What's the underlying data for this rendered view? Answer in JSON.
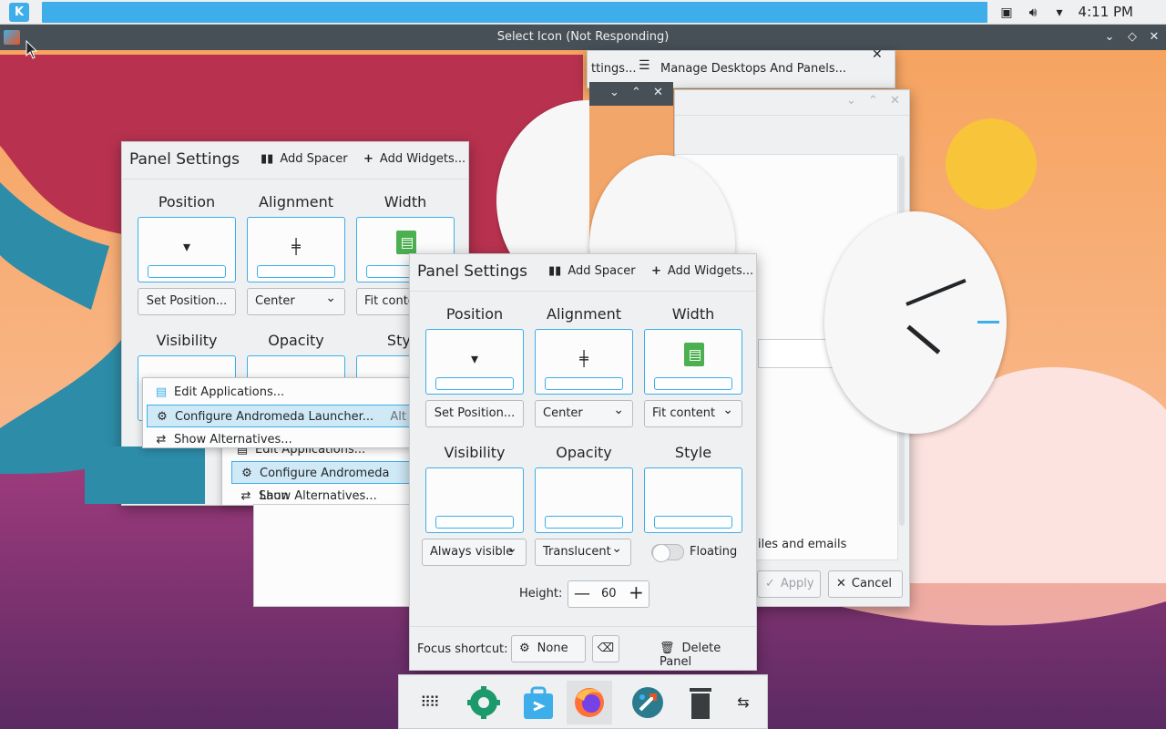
{
  "top_panel": {
    "logo_text": "K",
    "clock": "4:11 PM",
    "tray_icons": [
      "screen-lock-icon",
      "volume-icon",
      "tray-expand-icon"
    ]
  },
  "select_icon_window": {
    "title": "Select Icon (Not Responding)"
  },
  "background_window": {
    "tab_partial": "ttings...",
    "tab_manage": "Manage Desktops And Panels..."
  },
  "settings_window": {
    "text_partial": "iles and emails",
    "apply": "Apply",
    "cancel": "Cancel"
  },
  "panel_settings_back": {
    "title": "Panel Settings",
    "add_spacer": "Add Spacer",
    "add_widgets": "Add Widgets...",
    "labels": {
      "position": "Position",
      "alignment": "Alignment",
      "width": "Width",
      "visibility": "Visibility",
      "opacity": "Opacity",
      "style": "Style"
    },
    "set_position": "Set Position...",
    "alignment_value": "Center",
    "width_value": "Fit conte"
  },
  "context_menu_1": {
    "items": [
      {
        "label": "Edit Applications..."
      },
      {
        "label": "Configure Andromeda Launcher...",
        "shortcut": "Alt"
      },
      {
        "label": "Show Alternatives..."
      }
    ]
  },
  "context_menu_2": {
    "items": [
      {
        "label": "Edit Applications..."
      },
      {
        "label": "Configure Andromeda Laun"
      },
      {
        "label": "Show Alternatives..."
      }
    ]
  },
  "panel_settings": {
    "title": "Panel Settings",
    "add_spacer": "Add Spacer",
    "add_widgets": "Add Widgets...",
    "labels": {
      "position": "Position",
      "alignment": "Alignment",
      "width": "Width",
      "visibility": "Visibility",
      "opacity": "Opacity",
      "style": "Style"
    },
    "set_position": "Set Position...",
    "alignment_value": "Center",
    "width_value": "Fit content",
    "visibility_value": "Always visible",
    "opacity_value": "Translucent",
    "floating_label": "Floating",
    "height_label": "Height:",
    "height_value": "60",
    "focus_label": "Focus shortcut:",
    "focus_value": "None",
    "delete_panel": "Delete Panel"
  },
  "dock": {
    "items": [
      "app-grid-icon",
      "system-settings-icon",
      "discover-store-icon",
      "firefox-icon",
      "kde-plasma-icon",
      "trash-icon",
      "panel-configure-icon"
    ]
  },
  "colors": {
    "accent": "#3daee9",
    "window_bg": "#eff0f1",
    "titlebar": "#475057"
  }
}
